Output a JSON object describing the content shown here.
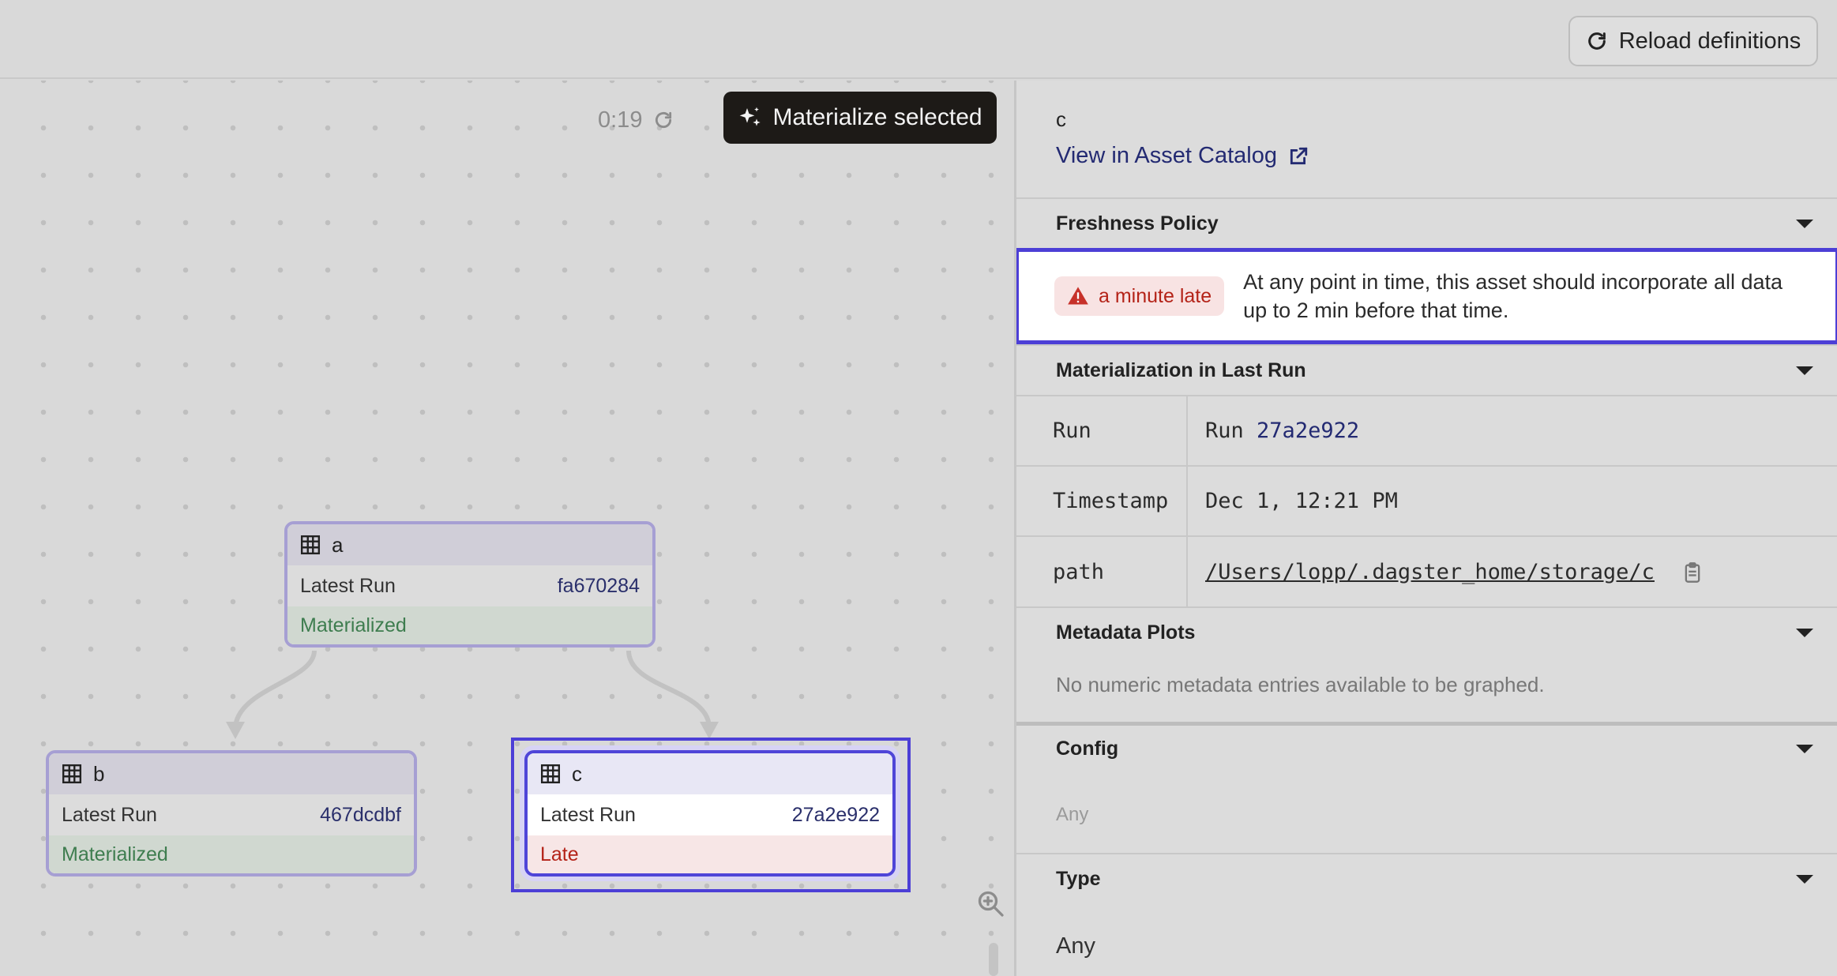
{
  "toolbar": {
    "reload_label": "Reload definitions"
  },
  "canvas": {
    "timer": "0:19",
    "materialize_label": "Materialize selected",
    "nodes": [
      {
        "name": "a",
        "run_label": "Latest Run",
        "run_id": "fa670284",
        "status": "Materialized"
      },
      {
        "name": "b",
        "run_label": "Latest Run",
        "run_id": "467dcdbf",
        "status": "Materialized"
      },
      {
        "name": "c",
        "run_label": "Latest Run",
        "run_id": "27a2e922",
        "status": "Late"
      }
    ]
  },
  "panel": {
    "asset_name": "c",
    "catalog_link": "View in Asset Catalog",
    "freshness": {
      "title": "Freshness Policy",
      "badge": "a minute late",
      "description": "At any point in time, this asset should incorporate all data up to 2 min before that time."
    },
    "materialization": {
      "title": "Materialization in Last Run",
      "rows": [
        {
          "key": "Run",
          "prefix": "Run",
          "value": "27a2e922"
        },
        {
          "key": "Timestamp",
          "value": "Dec 1, 12:21 PM"
        },
        {
          "key": "path",
          "value": "/Users/lopp/.dagster_home/storage/c"
        }
      ]
    },
    "metadata_plots": {
      "title": "Metadata Plots",
      "empty": "No numeric metadata entries available to be graphed."
    },
    "config": {
      "title": "Config",
      "value": "Any"
    },
    "type": {
      "title": "Type",
      "value": "Any"
    }
  },
  "colors": {
    "accent": "#4c3fd6",
    "materialized": "#3e7d4f",
    "late": "#b42318",
    "link": "#232a72"
  }
}
